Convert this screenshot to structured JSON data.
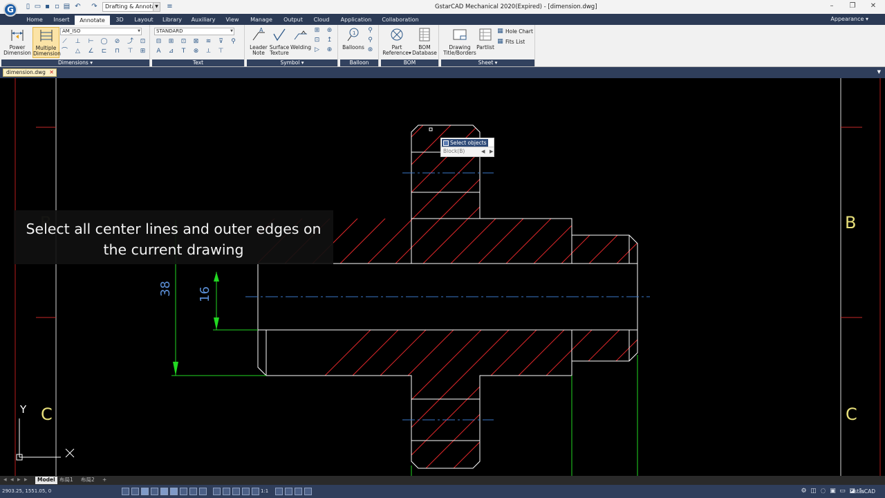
{
  "app": {
    "title": "GstarCAD Mechanical 2020(Expired) - [dimension.dwg]",
    "logo_letter": "G",
    "workspace": "Drafting & Annotati",
    "appearance": "Appearance"
  },
  "tabs": [
    {
      "label": "Home"
    },
    {
      "label": "Insert"
    },
    {
      "label": "Annotate",
      "active": true
    },
    {
      "label": "3D"
    },
    {
      "label": "Layout"
    },
    {
      "label": "Library"
    },
    {
      "label": "Auxiliary"
    },
    {
      "label": "View"
    },
    {
      "label": "Manage"
    },
    {
      "label": "Output"
    },
    {
      "label": "Cloud"
    },
    {
      "label": "Application"
    },
    {
      "label": "Collaboration"
    }
  ],
  "ribbon": {
    "dimensions": {
      "footer": "Dimensions",
      "power_dim": [
        "Power",
        "Dimension"
      ],
      "multiple_dim": [
        "Multiple",
        "Dimension"
      ],
      "style_combo": "AM_ISO"
    },
    "text": {
      "footer": "Text",
      "style_combo": "STANDARD"
    },
    "symbol": {
      "footer": "Symbol",
      "leader": [
        "Leader",
        "Note"
      ],
      "surface": [
        "Surface",
        "Texture"
      ],
      "welding": [
        "Welding",
        ""
      ]
    },
    "balloon": {
      "footer": "Balloon",
      "balloons": [
        "Balloons",
        ""
      ]
    },
    "bom": {
      "footer": "BOM",
      "part_ref": [
        "Part",
        "Reference"
      ],
      "bom_db": [
        "BOM",
        "Database"
      ]
    },
    "sheet": {
      "footer": "Sheet",
      "drawing": [
        "Drawing",
        "Title/Borders"
      ],
      "partlist": [
        "Partlist",
        ""
      ],
      "hole_chart": "Hole Chart",
      "fits_list": "Fits List"
    }
  },
  "document": {
    "tab_label": "dimension.dwg"
  },
  "drawing": {
    "dim_38": "38",
    "dim_16": "16",
    "border_B_left": "B",
    "border_B_right": "B",
    "border_C_left": "C",
    "border_C_right": "C",
    "ucs_x": "X",
    "ucs_y": "Y",
    "colors": {
      "outline": "#ffffff",
      "hatch": "#e0282b",
      "center": "#3a78c9",
      "dimension": "#22d822",
      "border": "#d8d8d8",
      "zone_tick": "#c62828",
      "border_letter": "#e8e07a"
    }
  },
  "caption": {
    "line1": "Select all center lines and outer edges on",
    "line2": "the current drawing"
  },
  "prompt": {
    "label": "Select objects",
    "option": "Block(B)"
  },
  "layouts": {
    "model": "Model",
    "layout1": "布局1",
    "layout2": "布局2",
    "add": "+"
  },
  "status": {
    "coords": "2903.25, 1551.05, 0",
    "scale": "1:1",
    "brand": "GstarCAD"
  }
}
